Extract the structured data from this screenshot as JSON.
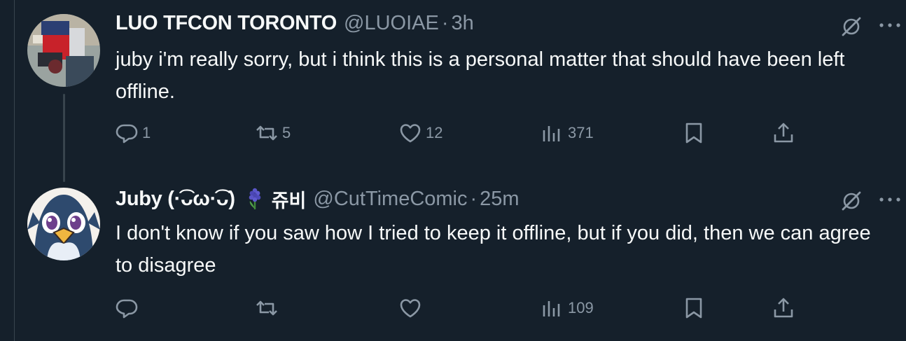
{
  "tweets": [
    {
      "display_name": "LUO TFCON TORONTO",
      "handle": "@LUOIAE",
      "separator": "·",
      "time": "3h",
      "text": "juby i'm really sorry, but i think this is a personal matter that should have been left offline.",
      "reply_count": "1",
      "retweet_count": "5",
      "like_count": "12",
      "view_count": "371"
    },
    {
      "display_name": "Juby (·͡ᴗω·͡ᴗ)",
      "korean_name": "쥬비",
      "handle": "@CutTimeComic",
      "separator": "·",
      "time": "25m",
      "text": "I don't know if you saw how I tried to keep it offline, but if you did, then we can agree to disagree",
      "reply_count": "",
      "retweet_count": "",
      "like_count": "",
      "view_count": "109"
    }
  ],
  "colors": {
    "background": "#15202b",
    "text_primary": "#f7f9f9",
    "text_secondary": "#8b98a5",
    "thread_line": "#38444d"
  },
  "icons": [
    "grok-icon",
    "more-icon",
    "reply-icon",
    "retweet-icon",
    "like-icon",
    "views-icon",
    "bookmark-icon",
    "share-icon",
    "hyacinth-emoji"
  ]
}
